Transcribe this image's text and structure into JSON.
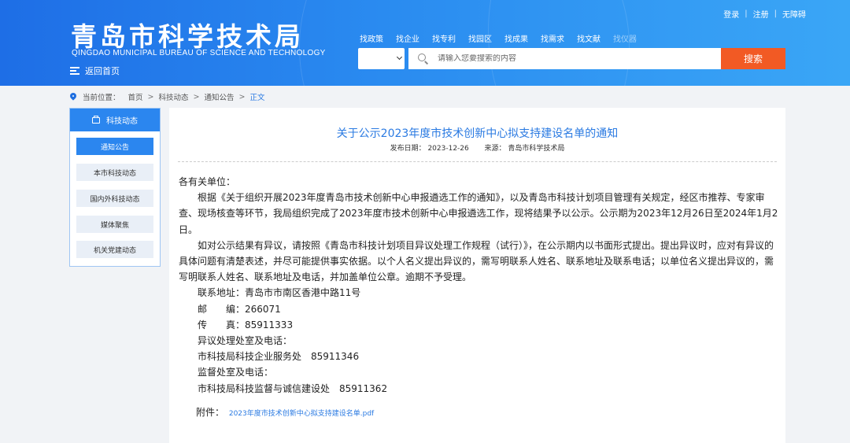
{
  "header": {
    "title": "青岛市科学技术局",
    "subtitle": "QINGDAO MUNICIPAL BUREAU OF SCIENCE AND TECHNOLOGY",
    "home_link": "返回首页",
    "top_links": {
      "login": "登录",
      "register": "注册",
      "accessibility": "无障碍"
    },
    "nav": [
      "找政策",
      "找企业",
      "找专利",
      "找园区",
      "找成果",
      "找需求",
      "找文献",
      "找仪器"
    ],
    "search": {
      "select_value": "",
      "placeholder": "请输入您要搜索的内容",
      "button": "搜索"
    }
  },
  "breadcrumb": {
    "label": "当前位置：",
    "items": [
      "首页",
      "科技动态",
      "通知公告"
    ],
    "current": "正文"
  },
  "sidebar": {
    "title": "科技动态",
    "items": [
      {
        "label": "通知公告",
        "active": true
      },
      {
        "label": "本市科技动态",
        "active": false
      },
      {
        "label": "国内外科技动态",
        "active": false
      },
      {
        "label": "媒体聚焦",
        "active": false
      },
      {
        "label": "机关党建动态",
        "active": false
      }
    ]
  },
  "article": {
    "title": "关于公示2023年度市技术创新中心拟支持建设名单的通知",
    "date_label": "发布日期：",
    "date": "2023-12-26",
    "source_label": "来源：",
    "source": "青岛市科学技术局",
    "salutation": "各有关单位：",
    "paragraph1": "根据《关于组织开展2023年度青岛市技术创新中心申报遴选工作的通知》，以及青岛市科技计划项目管理有关规定，经区市推荐、专家审查、现场核查等环节，我局组织完成了2023年度市技术创新中心申报遴选工作，现将结果予以公示。公示期为2023年12月26日至2024年1月2日。",
    "paragraph2": "如对公示结果有异议，请按照《青岛市科技计划项目异议处理工作规程（试行）》，在公示期内以书面形式提出。提出异议时，应对有异议的具体问题有清楚表述，并尽可能提供事实依据。以个人名义提出异议的，需写明联系人姓名、联系地址及联系电话；以单位名义提出异议的，需写明联系人姓名、联系地址及电话，并加盖单位公章。逾期不予受理。",
    "contact_lines": [
      "联系地址：青岛市市南区香港中路11号",
      "邮　　编：266071",
      "传　　真：85911333",
      "异议处理处室及电话：",
      "市科技局科技企业服务处　85911346",
      "监督处室及电话：",
      "市科技局科技监督与诚信建设处　85911362"
    ],
    "attachment_label": "附件：",
    "attachment_name": "2023年度市技术创新中心拟支持建设名单.pdf"
  }
}
